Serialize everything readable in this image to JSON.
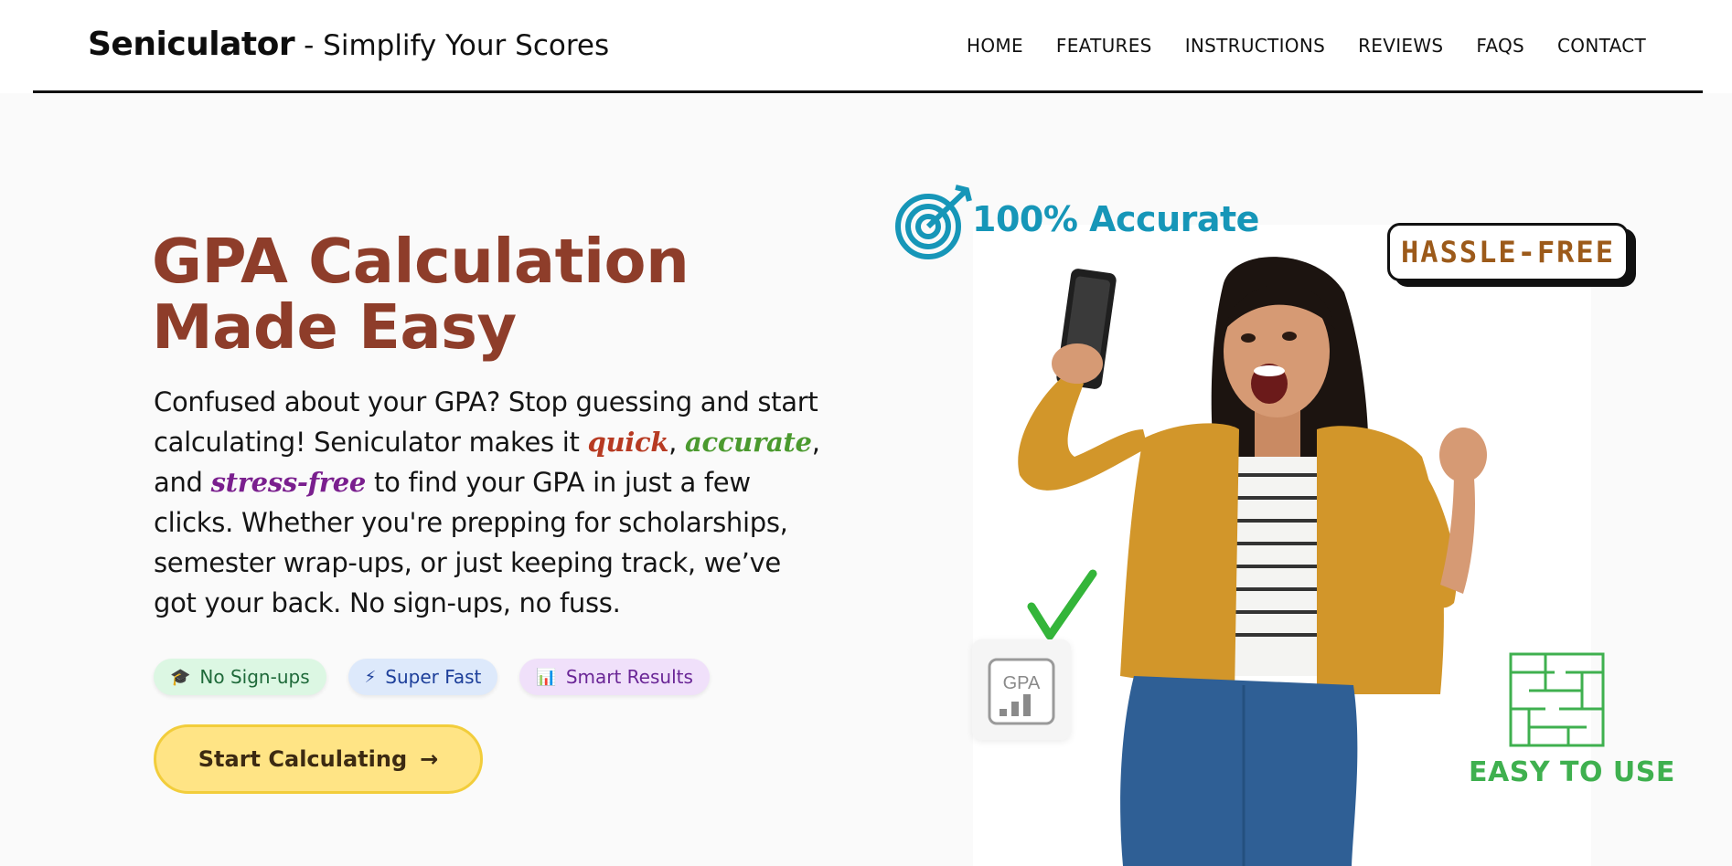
{
  "header": {
    "brand_name": "Seniculator",
    "brand_tagline": "- Simplify Your Scores",
    "nav": [
      "HOME",
      "FEATURES",
      "INSTRUCTIONS",
      "REVIEWS",
      "FAQS",
      "CONTACT"
    ]
  },
  "hero": {
    "title_line1": "GPA Calculation",
    "title_line2": "Made Easy",
    "desc_part1": "Confused about your GPA? Stop guessing and start calculating! Seniculator makes it ",
    "hl_quick": "quick",
    "desc_part2": ", ",
    "hl_accurate": "accurate",
    "desc_part3": ", and ",
    "hl_stress": "stress-free",
    "desc_part4": " to find your GPA in just a few clicks. Whether you're prepping for scholarships, semester wrap-ups, or just keeping track, we’ve got your back. No sign-ups, no fuss.",
    "pills": [
      {
        "icon": "graduation-cap-icon",
        "glyph": "🎓",
        "label": "No Sign-ups"
      },
      {
        "icon": "lightning-icon",
        "glyph": "⚡",
        "label": "Super Fast"
      },
      {
        "icon": "bar-chart-icon",
        "glyph": "📊",
        "label": "Smart Results"
      }
    ],
    "cta_label": "Start Calculating",
    "cta_arrow": "→"
  },
  "illustration": {
    "accurate_text": "100% Accurate",
    "hassle_text": "HASSLE-FREE",
    "easy_text": "EASY TO USE",
    "gpa_card_text": "GPA"
  },
  "colors": {
    "title": "#8e3d2a",
    "quick": "#b73a22",
    "accurate": "#4b9a2f",
    "stress_free": "#7a1f8e",
    "cta_bg": "#ffe485",
    "cta_border": "#f2cd3b",
    "accurate_label": "#1696b8",
    "easy_label": "#3fb04f"
  }
}
